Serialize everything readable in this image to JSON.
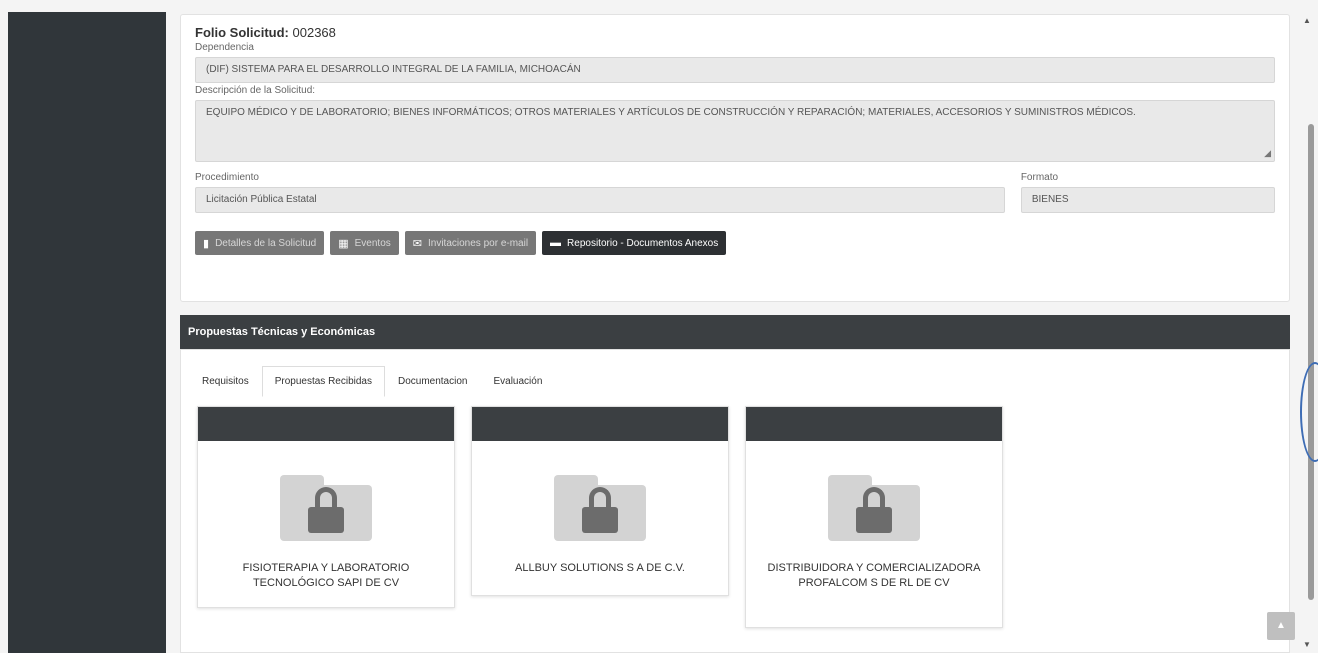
{
  "sidebar": {},
  "solicitud": {
    "folio_label": "Folio Solicitud:",
    "folio_value": "002368",
    "dependencia_label": "Dependencia",
    "dependencia_value": "(DIF) SISTEMA PARA EL DESARROLLO INTEGRAL DE LA FAMILIA, MICHOACÁN",
    "descripcion_label": "Descripción de la Solicitud:",
    "descripcion_value": "EQUIPO MÉDICO Y DE LABORATORIO; BIENES INFORMÁTICOS; OTROS MATERIALES Y ARTÍCULOS DE CONSTRUCCIÓN Y REPARACIÓN; MATERIALES, ACCESORIOS Y SUMINISTROS MÉDICOS.",
    "procedimiento_label": "Procedimiento",
    "procedimiento_value": "Licitación Pública Estatal",
    "formato_label": "Formato",
    "formato_value": "BIENES"
  },
  "buttons": {
    "detalles": "Detalles de la Solicitud",
    "eventos": "Eventos",
    "invitaciones": "Invitaciones por e-mail",
    "repositorio": "Repositorio - Documentos Anexos"
  },
  "propuestas": {
    "header": "Propuestas Técnicas y Económicas",
    "tabs": [
      "Requisitos",
      "Propuestas Recibidas",
      "Documentacion",
      "Evaluación"
    ],
    "active_tab": "Propuestas Recibidas",
    "cards": [
      {
        "name": "FISIOTERAPIA Y LABORATORIO TECNOLÓGICO SAPI DE CV",
        "icon": "locked-folder-icon"
      },
      {
        "name": "ALLBUY SOLUTIONS S A  DE C.V.",
        "icon": "locked-folder-icon"
      },
      {
        "name": "DISTRIBUIDORA Y COMERCIALIZADORA PROFALCOM S DE RL DE CV",
        "icon": "locked-folder-icon"
      }
    ]
  },
  "colors": {
    "sidebar": "#30363a",
    "panel_header": "#3b3f42",
    "button_disabled": "#777777",
    "button_active": "#2d3033"
  }
}
